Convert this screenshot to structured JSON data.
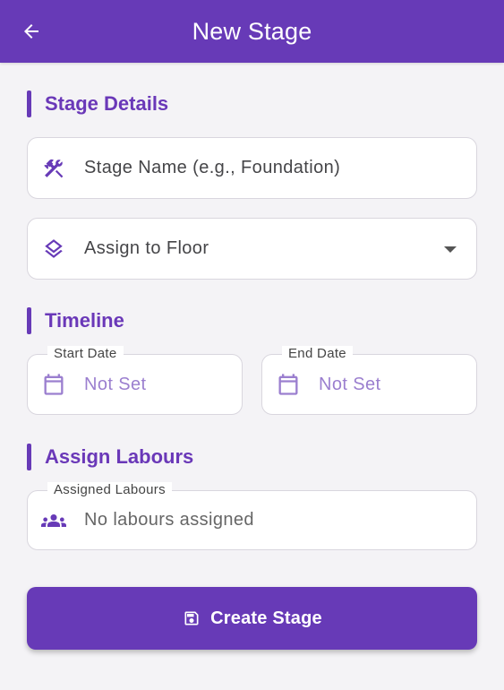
{
  "appbar": {
    "title": "New Stage",
    "back_icon": "arrow-back-icon",
    "color": "#673ab7"
  },
  "sections": {
    "stage_details": "Stage Details",
    "timeline": "Timeline",
    "assign_labours": "Assign Labours"
  },
  "stage_name": {
    "placeholder": "Stage Name (e.g., Foundation)",
    "icon": "construction-tools-icon"
  },
  "floor": {
    "value": "Assign to Floor",
    "icon": "layers-icon"
  },
  "start_date": {
    "label": "Start Date",
    "value": "Not Set",
    "icon": "calendar-icon"
  },
  "end_date": {
    "label": "End Date",
    "value": "Not Set",
    "icon": "calendar-icon"
  },
  "labours": {
    "label": "Assigned Labours",
    "value": "No labours assigned",
    "icon": "groups-icon"
  },
  "create_button": {
    "label": "Create Stage",
    "icon": "save-icon"
  }
}
